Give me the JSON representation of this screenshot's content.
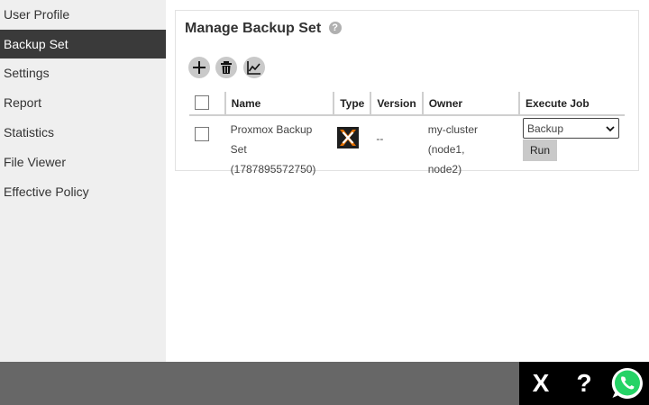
{
  "sidebar": {
    "items": [
      {
        "label": "User Profile"
      },
      {
        "label": "Backup Set"
      },
      {
        "label": "Settings"
      },
      {
        "label": "Report"
      },
      {
        "label": "Statistics"
      },
      {
        "label": "File Viewer"
      },
      {
        "label": "Effective Policy"
      }
    ],
    "active_index": 1
  },
  "panel": {
    "title": "Manage Backup Set",
    "help_glyph": "?"
  },
  "toolbar": {
    "icons": [
      "plus-icon",
      "trash-icon",
      "chart-icon"
    ]
  },
  "table": {
    "headers": {
      "name": "Name",
      "type": "Type",
      "version": "Version",
      "owner": "Owner",
      "execute_job": "Execute Job"
    },
    "rows": [
      {
        "name_line1": "Proxmox Backup Set",
        "name_line2": "(1787895572750)",
        "type_icon": "proxmox-icon",
        "version": "--",
        "owner_line1": "my-cluster (node1,",
        "owner_line2": "node2)",
        "job_selected": "Backup",
        "run_label": "Run"
      }
    ]
  },
  "footer": {
    "close_glyph": "X",
    "help_glyph": "?",
    "icons": [
      "close-icon",
      "help-icon",
      "whatsapp-icon"
    ]
  },
  "colors": {
    "sidebar_bg": "#efefef",
    "active_bg": "#3a3a3a",
    "footer_bg": "#676767",
    "proxmox_orange": "#e57000",
    "whatsapp_green": "#25d366"
  }
}
